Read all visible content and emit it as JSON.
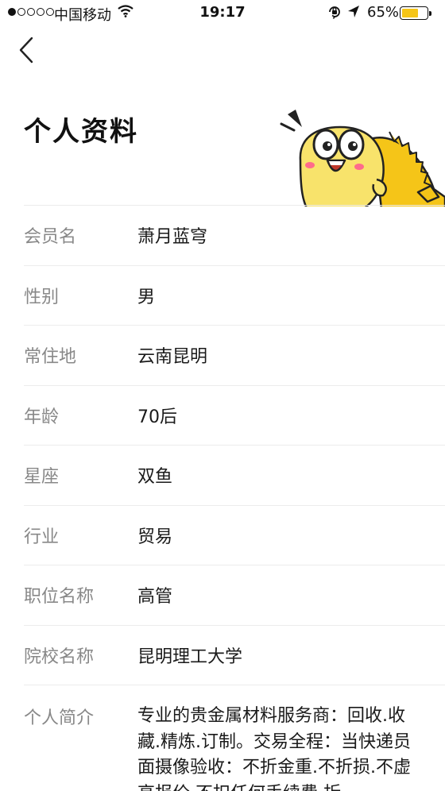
{
  "status_bar": {
    "carrier": "中国移动",
    "time": "19:17",
    "battery": "65%",
    "battery_level": 0.65,
    "signal_bars": 1
  },
  "header": {
    "back_icon": "chevron-left-icon",
    "title": "个人资料"
  },
  "profile": {
    "rows": [
      {
        "label": "会员名",
        "value": "萧月蓝穹"
      },
      {
        "label": "性别",
        "value": "男"
      },
      {
        "label": "常住地",
        "value": "云南昆明"
      },
      {
        "label": "年龄",
        "value": "70后"
      },
      {
        "label": "星座",
        "value": "双鱼"
      },
      {
        "label": "行业",
        "value": "贸易"
      },
      {
        "label": "职位名称",
        "value": "高管"
      },
      {
        "label": "院校名称",
        "value": "昆明理工大学"
      }
    ],
    "bio": {
      "label": "个人简介",
      "value": "专业的贵金属材料服务商：回收.收藏.精炼.订制。交易全程：当快递员面摄像验收：不折金重.不折损.不虚高报价.不扣任何手续费.折"
    }
  },
  "colors": {
    "accent": "#f5c518",
    "label": "#888888",
    "divider": "#ececec"
  }
}
